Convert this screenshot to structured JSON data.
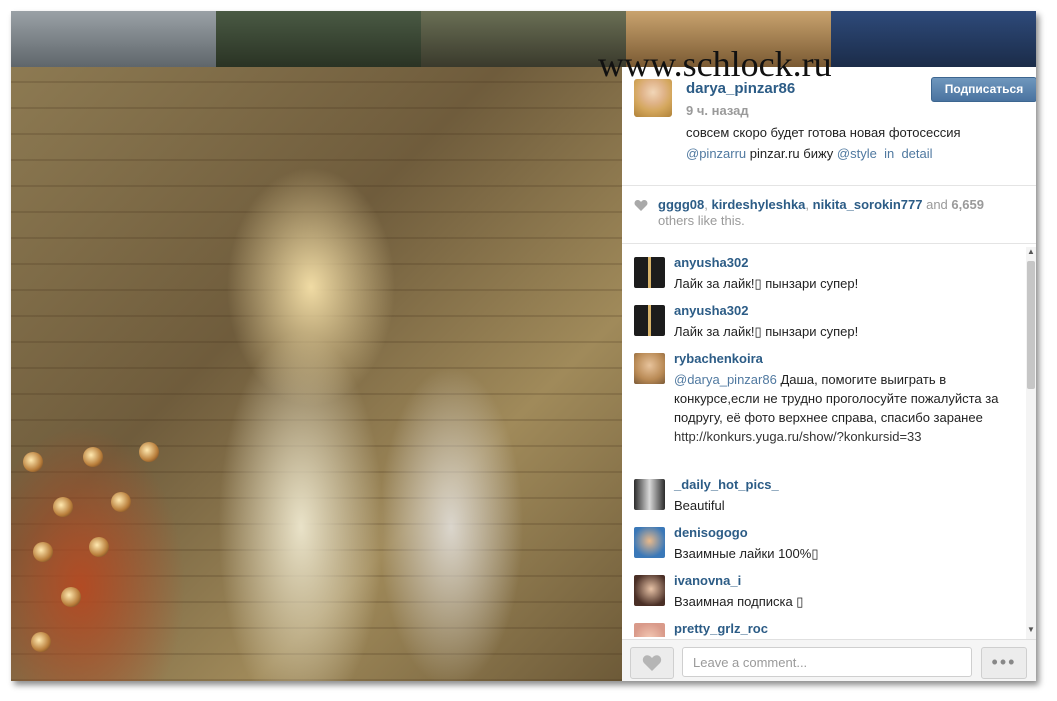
{
  "post": {
    "username": "darya_pinzar86",
    "time": "9 ч. назад",
    "caption_line1": "совсем скоро будет готова новая фотосессия",
    "caption_mention1": "@pinzarru",
    "caption_mid": " pinzar.ru бижу ",
    "caption_mention2": "@style",
    "caption_sep": "  in  ",
    "caption_mention3": "detail",
    "follow_label": "Подписаться"
  },
  "watermark": "www.schlock.ru",
  "likes": {
    "user1": "gggg08",
    "sep1": ", ",
    "user2": "kirdeshyleshka",
    "sep2": ", ",
    "user3": "nikita_sorokin777",
    "and": " and ",
    "count": "6,659",
    "rest": "others like this."
  },
  "comments": [
    {
      "name": "anyusha302",
      "text": "Лайк за лайк!▯ пынзари супер!"
    },
    {
      "name": "anyusha302",
      "text": "Лайк за лайк!▯ пынзари супер!"
    },
    {
      "name": "rybachenkoira",
      "mention": "@darya_pinzar86",
      "text": " Даша, помогите выиграть в конкурсе,если не трудно проголосуйте пожалуйста за подругу, её фото верхнее справа, спасибо заранее ",
      "link": "http://konkurs.yuga.ru/show/?konkursid=33"
    },
    {
      "name": "_daily_hot_pics_",
      "text": "Beautiful"
    },
    {
      "name": "denisogogo",
      "text": "Взаимные лайки 100%▯"
    },
    {
      "name": "ivanovna_i",
      "text": "Взаимная подписка ▯"
    },
    {
      "name": "pretty_grlz_roc",
      "text": ""
    }
  ],
  "footer": {
    "comment_placeholder": "Leave a comment...",
    "more_label": "•••"
  },
  "icons": {
    "like": "heart-icon",
    "more": "more-icon",
    "scroll_up": "chevron-up-icon",
    "scroll_down": "chevron-down-icon"
  },
  "colors": {
    "username": "#2c5c86",
    "follow_button": "#4a73a0",
    "meta": "#9a9a9a"
  }
}
